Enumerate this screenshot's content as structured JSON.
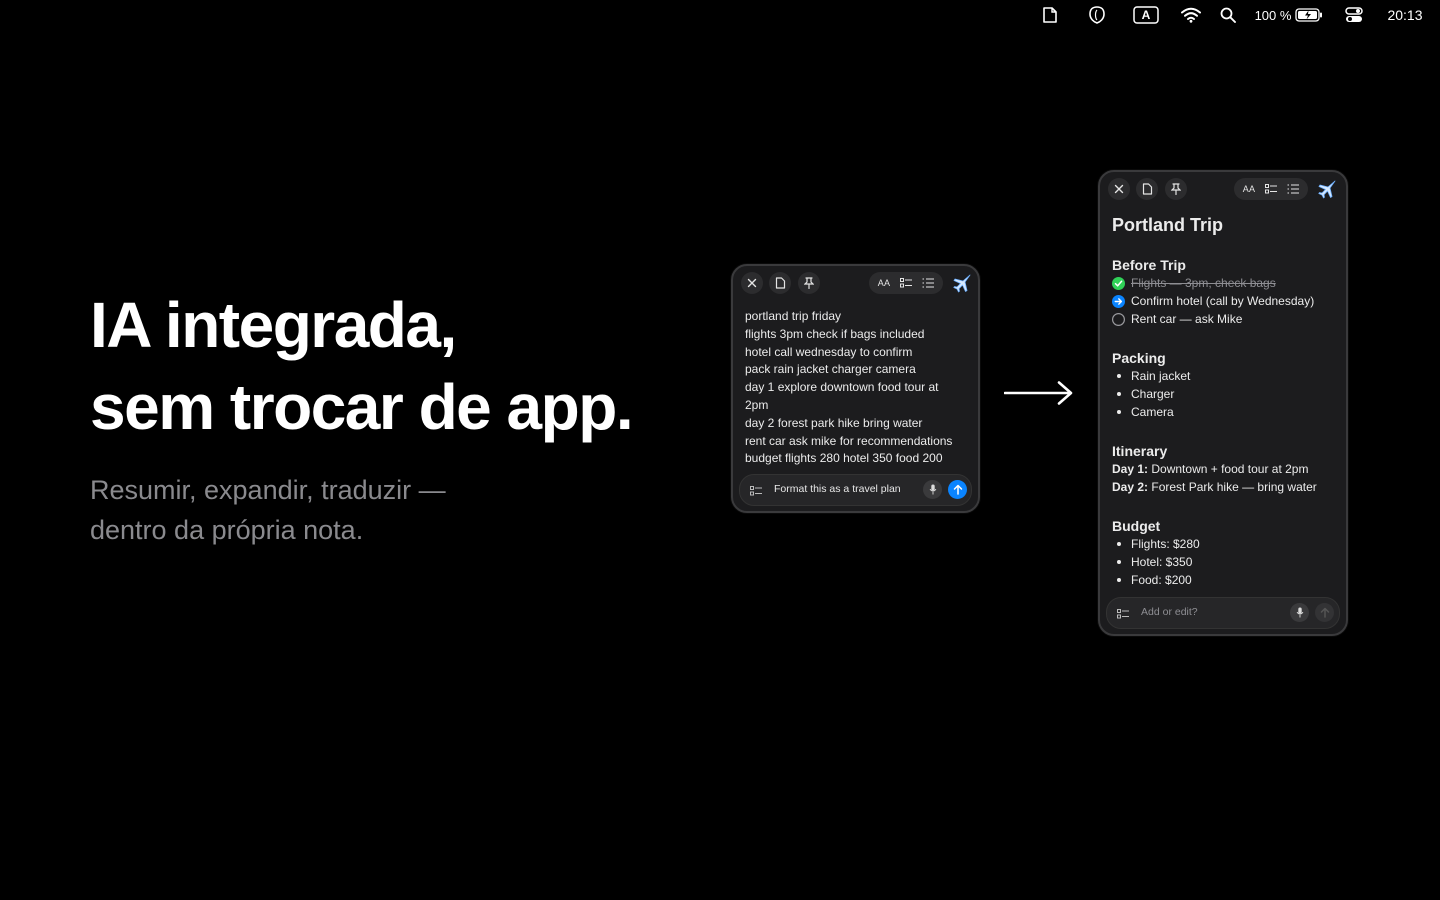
{
  "menubar": {
    "icons": [
      "note-icon",
      "shield-icon",
      "input-source-icon",
      "wifi-icon",
      "search-icon",
      "battery-icon",
      "control-center-icon"
    ],
    "input_source": "A",
    "battery_percent": "100 %",
    "battery_level": 1.0,
    "clock": "20:13"
  },
  "hero": {
    "headline_line1": "IA integrada,",
    "headline_line2": "sem trocar de app.",
    "sub_line1": "Resumir, expandir, traduzir —",
    "sub_line2": "dentro da própria nota."
  },
  "raw_note": {
    "toolbar": {
      "close": "close-icon",
      "doc": "document-icon",
      "pin": "pin-icon",
      "text_format": "AA",
      "checklist": "checklist-icon",
      "list": "list-icon",
      "ai": "airplane-ai-icon"
    },
    "lines": [
      "portland trip friday",
      "flights 3pm check if bags included",
      "hotel call wednesday to confirm",
      "pack rain jacket charger camera",
      "day 1 explore downtown food tour at",
      "2pm",
      "day 2 forest park hike bring water",
      "rent car ask mike for recommendations",
      "budget flights 280 hotel 350 food 200"
    ],
    "prompt": "Format this as a travel plan",
    "send_color": "#0a84ff"
  },
  "formatted_note": {
    "toolbar": {
      "text_format": "AA"
    },
    "title": "Portland Trip",
    "before_trip": {
      "heading": "Before Trip",
      "items": [
        {
          "text": "Flights — 3pm, check bags",
          "state": "done"
        },
        {
          "text": "Confirm hotel (call by Wednesday)",
          "state": "in-progress"
        },
        {
          "text": "Rent car — ask Mike",
          "state": "todo"
        }
      ]
    },
    "packing": {
      "heading": "Packing",
      "items": [
        "Rain jacket",
        "Charger",
        "Camera"
      ]
    },
    "itinerary": {
      "heading": "Itinerary",
      "days": [
        {
          "label": "Day 1:",
          "text": "Downtown + food tour at 2pm"
        },
        {
          "label": "Day 2:",
          "text": "Forest Park hike — bring water"
        }
      ]
    },
    "budget": {
      "heading": "Budget",
      "items": [
        "Flights: $280",
        "Hotel: $350",
        "Food: $200"
      ]
    },
    "prompt_placeholder": "Add or edit?"
  },
  "colors": {
    "done_green": "#30d158",
    "progress_blue": "#0a84ff",
    "muted_text": "#8a8a8e"
  }
}
